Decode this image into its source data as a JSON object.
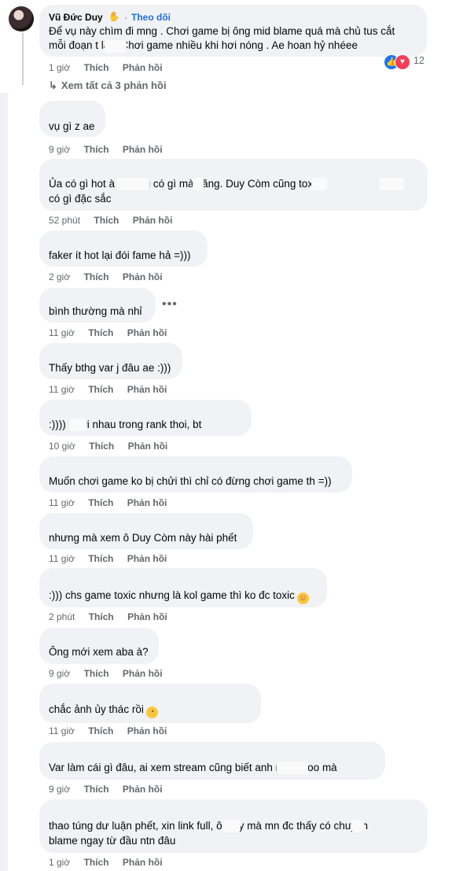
{
  "top_comment": {
    "author": "Vũ Đức Duy",
    "follow": "Theo dõi",
    "line1": "Để vụ này chìm đi mng . Chơi game bị ông mid blame quá mà chủ tus cắt",
    "line2": "mỗi đoạn t        lại . Chơi game nhiều khi hơi nóng . Ae hoan hỷ nhéee",
    "time": "1 giờ",
    "like": "Thích",
    "reply": "Phản hồi",
    "reaction_count": "12",
    "reaction_icons": [
      "like-icon",
      "love-icon"
    ]
  },
  "view_all": "Xem tất cả 3 phản hồi",
  "comments": [
    {
      "lines": [
        "vụ gì z ae"
      ],
      "time": "9 giờ",
      "like": "Thích",
      "reply": "Phản hồi"
    },
    {
      "lines": [
        "Ủa có gì hot à ?          nhau có       gì mà căng. Duy Còm        cũng toxic            ,",
        "có gì đặc sắc"
      ],
      "time": "52 phút",
      "like": "Thích",
      "reply": "Phản hồi"
    },
    {
      "lines": [
        "faker ít hot lại đói fame hả =)))"
      ],
      "time": "2 giờ",
      "like": "Thích",
      "reply": "Phản hồi"
    },
    {
      "lines": [
        "bình thường mà nhỉ"
      ],
      "time": "11 giờ",
      "like": "Thích",
      "reply": "Phản hồi"
    },
    {
      "lines": [
        "Thấy bthg var j đâu ae :)))"
      ],
      "time": "11 giờ",
      "like": "Thích",
      "reply": "Phản hồi"
    },
    {
      "lines": [
        ":))))      chửi nhau trong rank thoi, bt"
      ],
      "time": "10 giờ",
      "like": "Thích",
      "reply": "Phản hồi"
    },
    {
      "lines": [
        "Muốn chơi game ko bị chửi thì chỉ có đừng chơi game th =))"
      ],
      "time": "11 giờ",
      "like": "Thích",
      "reply": "Phản hồi"
    },
    {
      "lines": [
        "nhưng mà xem ô Duy Còm này hài phết"
      ],
      "time": "11 giờ",
      "like": "Thích",
      "reply": "Phản hồi"
    },
    {
      "lines": [
        ":))) chs game toxic nhưng là kol game thì ko đc toxic"
      ],
      "time": "2 phút",
      "like": "Thích",
      "reply": "Phản hồi"
    },
    {
      "lines": [
        "Ông mới xem aba à?"
      ],
      "time": "9 giờ",
      "like": "Thích",
      "reply": "Phản hồi"
    },
    {
      "lines": [
        "chắc ảnh ủy thác rồi"
      ],
      "time": "11 giờ",
      "like": "Thích",
      "reply": "Phản hồi"
    },
    {
      "lines": [
        "Var làm cái gì đâu, ai xem stream cũng biết anh           này ngoo mà"
      ],
      "time": "9 giờ",
      "like": "Thích",
      "reply": "Phản hồi"
    },
    {
      "lines": [
        "thao túng dư luận phết, xin link full,        ô Duy mà mn đc thấy     có chuyện",
        "blame ngay từ đầu ntn đâu"
      ],
      "time": "1 giờ",
      "like": "Thích",
      "reply": "Phản hồi"
    }
  ],
  "more_options": "•••",
  "colors": {
    "bubble": "#f0f2f5",
    "meta": "#65676b",
    "link": "#216fdb",
    "like": "#1877f2",
    "love": "#f33e58"
  }
}
